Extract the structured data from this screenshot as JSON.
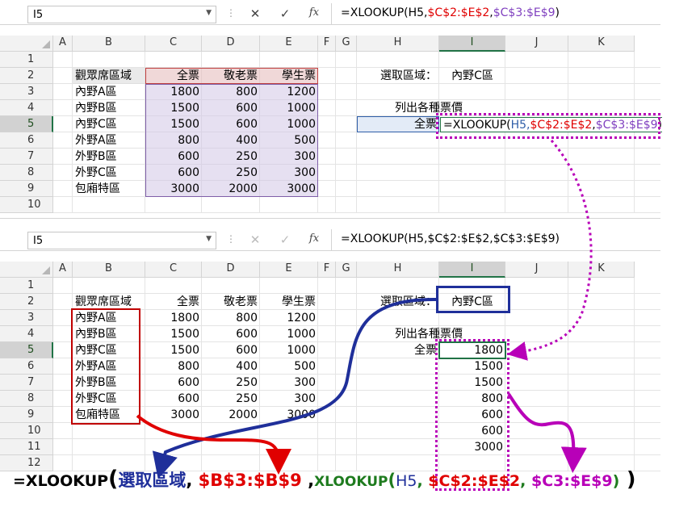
{
  "panel1": {
    "name_box": "I5",
    "formula_plain": "=XLOOKUP(H5,",
    "formula_ref1": "$C$2:$E$2",
    "formula_ref2": "$C$3:$E$9",
    "formula_close": ")"
  },
  "panel2": {
    "name_box": "I5",
    "formula": "=XLOOKUP(H5,$C$2:$E$2,$C$3:$E$9)"
  },
  "columns": [
    "A",
    "B",
    "C",
    "D",
    "E",
    "F",
    "G",
    "H",
    "I",
    "J",
    "K"
  ],
  "rows_panel1": [
    "1",
    "2",
    "3",
    "4",
    "5",
    "6",
    "7",
    "8",
    "9",
    "10"
  ],
  "rows_panel2": [
    "1",
    "2",
    "3",
    "4",
    "5",
    "6",
    "7",
    "8",
    "9",
    "10",
    "11",
    "12"
  ],
  "table": {
    "headers": [
      "觀眾席區域",
      "全票",
      "敬老票",
      "學生票"
    ],
    "rows": [
      [
        "內野A區",
        "1800",
        "800",
        "1200"
      ],
      [
        "內野B區",
        "1500",
        "600",
        "1000"
      ],
      [
        "內野C區",
        "1500",
        "600",
        "1000"
      ],
      [
        "外野A區",
        "800",
        "400",
        "500"
      ],
      [
        "外野B區",
        "600",
        "250",
        "300"
      ],
      [
        "外野C區",
        "600",
        "250",
        "300"
      ],
      [
        "包廂特區",
        "3000",
        "2000",
        "3000"
      ]
    ]
  },
  "side": {
    "select_label": "選取區域：",
    "select_value": "內野C區",
    "list_label": "列出各種票價",
    "row_label": "全票",
    "editing_prefix": "=XLOOKUP(",
    "editing_h5": "H5,",
    "editing_ref1": "$C$2:$E$2",
    "editing_comma": ",",
    "editing_ref2": "$C$3:$E$9",
    "editing_close": ")",
    "results": [
      "1800",
      "1500",
      "1500",
      "800",
      "600",
      "600",
      "3000"
    ]
  },
  "bottom_formula": {
    "p1": "=XLOOKUP",
    "open": "(",
    "p2": "選取區域",
    "c1": ",",
    "p3": " $B$3:$B$9",
    "c2": " ,",
    "p4": "XLOOKUP",
    "open2": "(",
    "p5": "H5",
    "c3": ",",
    "p6": " $C$2:$E$2",
    "c4": ",",
    "p7": " $C3:$E$9",
    "close2": ")",
    "close": " )"
  },
  "colors": {
    "red": "#e00000",
    "blue": "#1f2f9a",
    "green": "#1e7b1e",
    "magenta": "#b800b8",
    "excel_green": "#217346"
  },
  "icons": [
    "dropdown-arrow-icon",
    "cancel-x-icon",
    "confirm-check-icon",
    "function-fx-icon"
  ]
}
